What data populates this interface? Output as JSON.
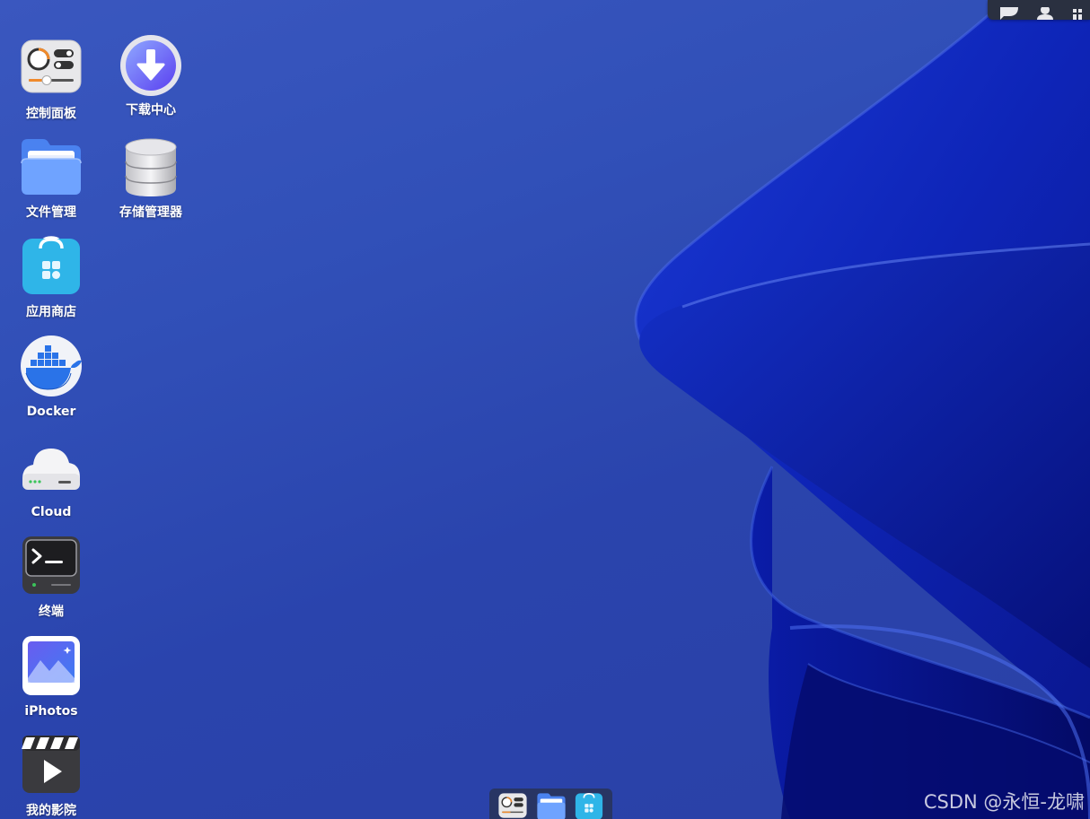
{
  "desktop": {
    "icons": [
      {
        "label": "控制面板",
        "icon": "control-panel-icon"
      },
      {
        "label": "下载中心",
        "icon": "download-center-icon"
      },
      {
        "label": "文件管理",
        "icon": "file-manager-icon"
      },
      {
        "label": "存储管理器",
        "icon": "storage-manager-icon"
      },
      {
        "label": "应用商店",
        "icon": "app-store-icon"
      },
      {
        "label": "Docker",
        "icon": "docker-icon"
      },
      {
        "label": "Cloud",
        "icon": "cloud-icon"
      },
      {
        "label": "终端",
        "icon": "terminal-icon"
      },
      {
        "label": "iPhotos",
        "icon": "iphotos-icon"
      },
      {
        "label": "我的影院",
        "icon": "my-cinema-icon"
      }
    ]
  },
  "topbar": {
    "icons": [
      "chat-icon",
      "user-icon",
      "grid-icon"
    ]
  },
  "dock": {
    "items": [
      "control-panel-icon",
      "file-manager-icon",
      "app-store-icon"
    ]
  },
  "watermark": "CSDN @永恒-龙啸",
  "colors": {
    "background": "#3150b8",
    "wave": "#0a1a9a",
    "label": "#ffffff"
  }
}
